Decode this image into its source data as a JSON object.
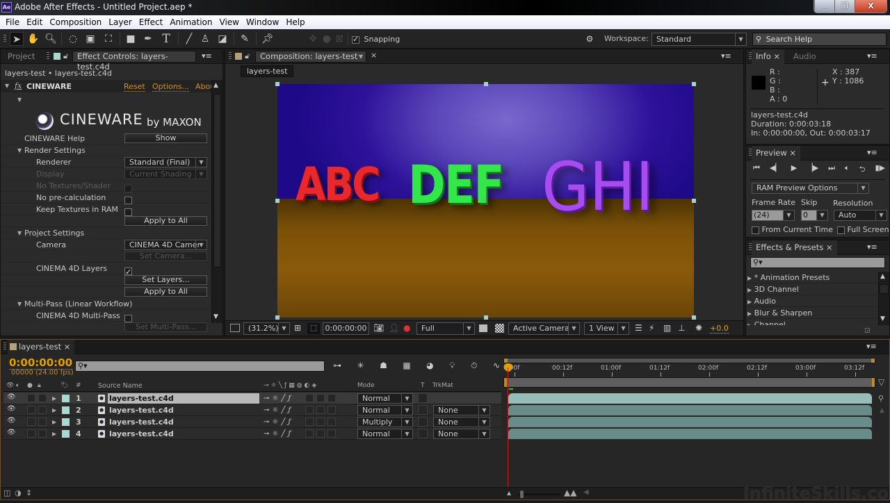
{
  "app": {
    "title": "Adobe After Effects - Untitled Project.aep *",
    "badge": "Ae",
    "window_controls": {
      "minimize": "_",
      "restore": "❐",
      "close": "X"
    }
  },
  "menu": [
    "File",
    "Edit",
    "Composition",
    "Layer",
    "Effect",
    "Animation",
    "View",
    "Window",
    "Help"
  ],
  "toolbar": {
    "tools": [
      "selection-tool",
      "hand-tool",
      "zoom-tool",
      "rotation-tool",
      "camera-tool",
      "pan-behind-tool",
      "rectangle-tool",
      "pen-tool",
      "type-tool",
      "brush-tool",
      "clone-stamp-tool",
      "eraser-tool",
      "roto-brush-tool",
      "puppet-pin-tool"
    ],
    "snapping_label": "Snapping",
    "snapping_checked": true,
    "workspace_label": "Workspace:",
    "workspace_value": "Standard",
    "search_help_placeholder": "Search Help"
  },
  "effect_controls": {
    "tab_project": "Project",
    "tab_title": "Effect Controls: layers-test.c4d",
    "breadcrumb": "layers-test • layers-test.c4d",
    "effect_name": "CINEWARE",
    "effect_links": {
      "reset": "Reset",
      "options": "Options...",
      "about": "Abou"
    },
    "logo_main": "CINEWARE",
    "logo_by": "by MAXON",
    "help_label": "CINEWARE Help",
    "help_button": "Show",
    "render_settings": {
      "header": "Render Settings",
      "renderer_label": "Renderer",
      "renderer_value": "Standard (Final)",
      "display_label": "Display",
      "display_value": "Current Shading",
      "no_textures_label": "No Textures/Shader",
      "no_precalc_label": "No pre-calculation",
      "keep_textures_label": "Keep Textures in RAM",
      "apply_all": "Apply to All"
    },
    "project_settings": {
      "header": "Project Settings",
      "camera_label": "Camera",
      "camera_value": "CINEMA 4D Camer",
      "set_camera": "Set Camera...",
      "c4d_layers_label": "CINEMA 4D Layers",
      "c4d_layers_checked": true,
      "set_layers": "Set Layers...",
      "apply_all": "Apply to All"
    },
    "multipass": {
      "header": "Multi-Pass (Linear Workflow)",
      "c4d_multipass_label": "CINEMA 4D Multi-Pass",
      "set_multipass": "Set Multi-Pass..."
    }
  },
  "composition": {
    "tab_title": "Composition: layers-test",
    "comp_button": "layers-test",
    "scene_text": [
      "ABC",
      "DEF",
      "GHI"
    ],
    "scene_colors": {
      "abc": "#e8282c",
      "def": "#33e64a",
      "ghi": "#a64cf0"
    },
    "zoom": "(31.2%)",
    "timecode": "0:00:00:00",
    "resolution": "Full",
    "view": "Active Camera",
    "layout": "1 View",
    "exposure": "+0.0"
  },
  "info": {
    "tab_info": "Info",
    "tab_audio": "Audio",
    "r": "R :",
    "g": "G :",
    "b": "B :",
    "a": "A : 0",
    "x": "X : 387",
    "y": "Y : 1086",
    "layer": "layers-test.c4d",
    "duration": "Duration: 0:00:03:18",
    "inout": "In: 0:00:00:00, Out: 0:00:03:17"
  },
  "preview": {
    "tab": "Preview",
    "options": "RAM Preview Options",
    "frame_rate_label": "Frame Rate",
    "frame_rate_value": "(24)",
    "skip_label": "Skip",
    "skip_value": "0",
    "resolution_label": "Resolution",
    "resolution_value": "Auto",
    "from_current": "From Current Time",
    "full_screen": "Full Screen"
  },
  "effects_presets": {
    "tab": "Effects & Presets",
    "items": [
      "* Animation Presets",
      "3D Channel",
      "Audio",
      "Blur & Sharpen",
      "Channel"
    ]
  },
  "timeline": {
    "tab": "layers-test",
    "timecode": "0:00:00:00",
    "frames": "00000 (24.00 fps)",
    "columns": {
      "num": "#",
      "source": "Source Name",
      "mode": "Mode",
      "t": "T",
      "trkmat": "TrkMat"
    },
    "ruler": [
      "0:00f",
      "00:12f",
      "01:00f",
      "01:12f",
      "02:00f",
      "02:12f",
      "03:00f",
      "03:12f"
    ],
    "layers": [
      {
        "num": "1",
        "name": "layers-test.c4d",
        "mode": "Normal",
        "trkmat": "",
        "selected": true
      },
      {
        "num": "2",
        "name": "layers-test.c4d",
        "mode": "Normal",
        "trkmat": "None",
        "selected": false
      },
      {
        "num": "3",
        "name": "layers-test.c4d",
        "mode": "Multiply",
        "trkmat": "None",
        "selected": false
      },
      {
        "num": "4",
        "name": "layers-test.c4d",
        "mode": "Normal",
        "trkmat": "None",
        "selected": false
      }
    ],
    "label_color": "#a8d8d0"
  },
  "watermark": "InfiniteSkills.com"
}
